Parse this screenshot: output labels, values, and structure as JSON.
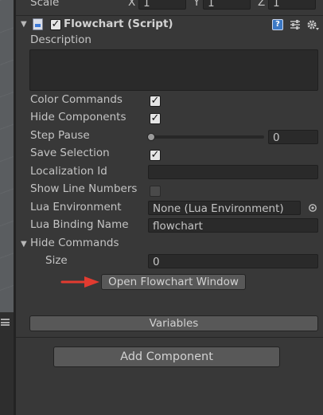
{
  "transform": {
    "scale_label": "Scale",
    "x_label": "X",
    "x_value": "1",
    "y_label": "Y",
    "y_value": "1",
    "z_label": "Z",
    "z_value": "1"
  },
  "component": {
    "title": "Flowchart (Script)",
    "enabled": true
  },
  "fields": {
    "description_label": "Description",
    "description_value": "",
    "color_commands_label": "Color Commands",
    "hide_components_label": "Hide Components",
    "step_pause_label": "Step Pause",
    "step_pause_value": "0",
    "save_selection_label": "Save Selection",
    "localization_id_label": "Localization Id",
    "localization_id_value": "",
    "show_line_numbers_label": "Show Line Numbers",
    "lua_environment_label": "Lua Environment",
    "lua_environment_value": "None (Lua Environment)",
    "lua_binding_name_label": "Lua Binding Name",
    "lua_binding_name_value": "flowchart",
    "hide_commands_label": "Hide Commands",
    "size_label": "Size",
    "size_value": "0"
  },
  "checkboxes": {
    "color_commands": true,
    "hide_components": true,
    "save_selection": true,
    "show_line_numbers": false
  },
  "buttons": {
    "open_flowchart_window": "Open Flowchart Window",
    "variables": "Variables",
    "add_component": "Add Component"
  },
  "colors": {
    "panel_bg": "#383838",
    "field_bg": "#2a2a2a",
    "annotation_arrow": "#e23b30",
    "text": "#c4c4c4"
  },
  "icons": {
    "component_icon": "script-icon",
    "help": "help-icon",
    "presets": "presets-icon",
    "settings": "gear-icon",
    "object_picker": "object-picker-icon",
    "menu": "hamburger-icon",
    "annotation": "red-arrow-icon"
  }
}
